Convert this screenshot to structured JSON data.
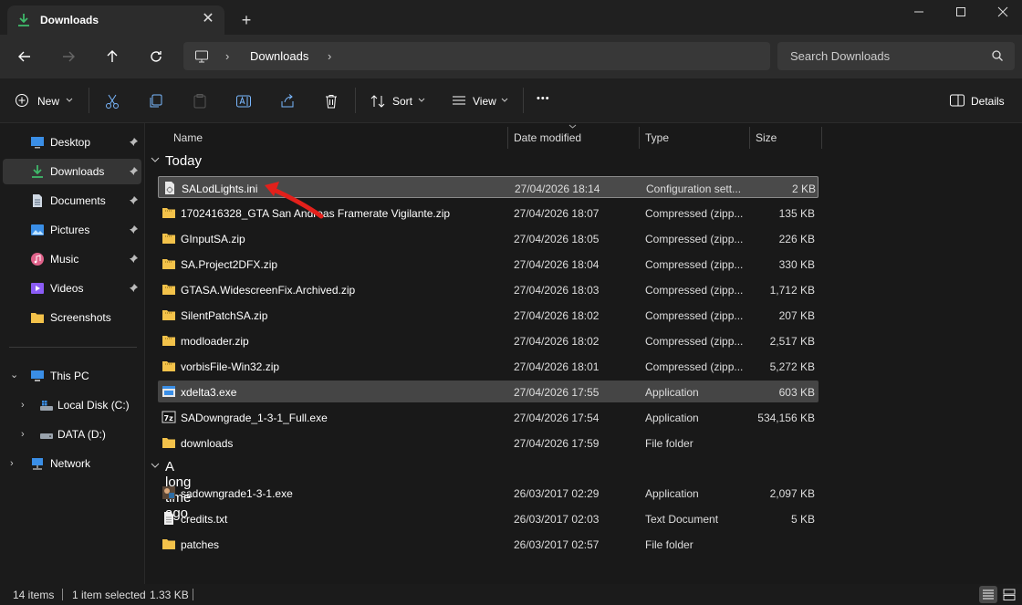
{
  "window": {
    "tab_title": "Downloads",
    "tab_close_glyph": "✕",
    "new_tab_glyph": "+"
  },
  "address": {
    "crumb": "Downloads",
    "chevron": "›",
    "search_placeholder": "Search Downloads"
  },
  "toolbar": {
    "new_label": "New",
    "sort_label": "Sort",
    "view_label": "View",
    "more_glyph": "•••",
    "details_label": "Details"
  },
  "sidebar": {
    "items": [
      {
        "label": "Desktop"
      },
      {
        "label": "Downloads"
      },
      {
        "label": "Documents"
      },
      {
        "label": "Pictures"
      },
      {
        "label": "Music"
      },
      {
        "label": "Videos"
      },
      {
        "label": "Screenshots"
      }
    ],
    "this_pc": "This PC",
    "local_disk": "Local Disk (C:)",
    "data_drive": "DATA (D:)",
    "network": "Network",
    "expand_glyph": "›",
    "expanded_glyph": "⌄"
  },
  "columns": {
    "name": "Name",
    "date": "Date modified",
    "type": "Type",
    "size": "Size"
  },
  "groups": {
    "today": "Today",
    "long_ago": "A long time ago"
  },
  "files_today": [
    {
      "name": "SALodLights.ini",
      "date": "27/04/2026 18:14",
      "type": "Configuration sett...",
      "size": "2 KB",
      "icon": "ini-file-icon"
    },
    {
      "name": "1702416328_GTA San Andreas Framerate Vigilante.zip",
      "date": "27/04/2026 18:07",
      "type": "Compressed (zipp...",
      "size": "135 KB",
      "icon": "zip-folder-icon"
    },
    {
      "name": "GInputSA.zip",
      "date": "27/04/2026 18:05",
      "type": "Compressed (zipp...",
      "size": "226 KB",
      "icon": "zip-folder-icon"
    },
    {
      "name": "SA.Project2DFX.zip",
      "date": "27/04/2026 18:04",
      "type": "Compressed (zipp...",
      "size": "330 KB",
      "icon": "zip-folder-icon"
    },
    {
      "name": "GTASA.WidescreenFix.Archived.zip",
      "date": "27/04/2026 18:03",
      "type": "Compressed (zipp...",
      "size": "1,712 KB",
      "icon": "zip-folder-icon"
    },
    {
      "name": "SilentPatchSA.zip",
      "date": "27/04/2026 18:02",
      "type": "Compressed (zipp...",
      "size": "207 KB",
      "icon": "zip-folder-icon"
    },
    {
      "name": "modloader.zip",
      "date": "27/04/2026 18:02",
      "type": "Compressed (zipp...",
      "size": "2,517 KB",
      "icon": "zip-folder-icon"
    },
    {
      "name": "vorbisFile-Win32.zip",
      "date": "27/04/2026 18:01",
      "type": "Compressed (zipp...",
      "size": "5,272 KB",
      "icon": "zip-folder-icon"
    },
    {
      "name": "xdelta3.exe",
      "date": "27/04/2026 17:55",
      "type": "Application",
      "size": "603 KB",
      "icon": "exe-icon"
    },
    {
      "name": "SADowngrade_1-3-1_Full.exe",
      "date": "27/04/2026 17:54",
      "type": "Application",
      "size": "534,156 KB",
      "icon": "7z-exe-icon"
    },
    {
      "name": "downloads",
      "date": "27/04/2026 17:59",
      "type": "File folder",
      "size": "",
      "icon": "folder-icon"
    }
  ],
  "files_old": [
    {
      "name": "sadowngrade1-3-1.exe",
      "date": "26/03/2017 02:29",
      "type": "Application",
      "size": "2,097 KB",
      "icon": "app-image-icon"
    },
    {
      "name": "credits.txt",
      "date": "26/03/2017 02:03",
      "type": "Text Document",
      "size": "5 KB",
      "icon": "text-file-icon"
    },
    {
      "name": "patches",
      "date": "26/03/2017 02:57",
      "type": "File folder",
      "size": "",
      "icon": "folder-icon"
    }
  ],
  "status": {
    "count": "14 items",
    "selected": "1 item selected",
    "size": "1.33 KB"
  },
  "colors": {
    "accent_blue": "#4cc2ff",
    "folder_yellow": "#f3c24a",
    "arrow_red": "#e3201b",
    "download_green": "#3fb86a"
  }
}
